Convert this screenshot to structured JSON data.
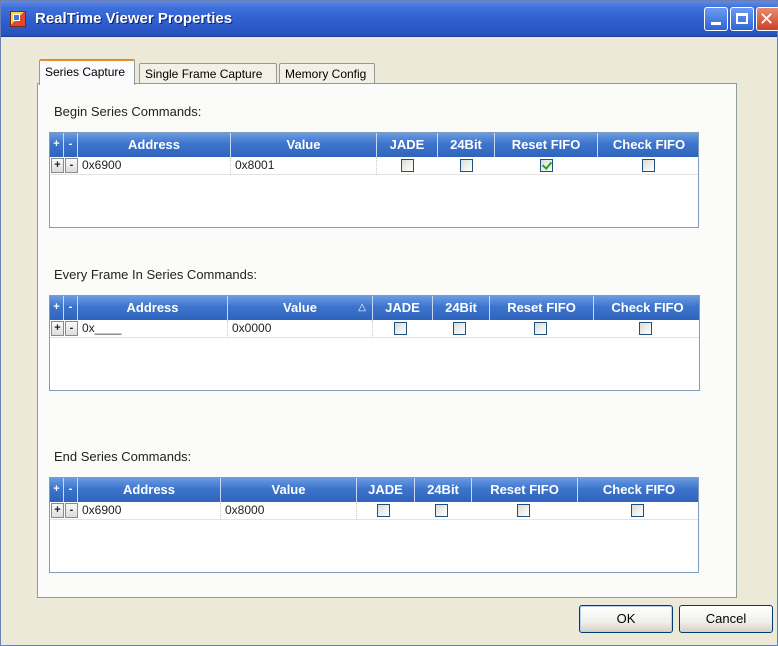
{
  "window": {
    "title": "RealTime Viewer Properties",
    "minimize_glyph": "",
    "close_glyph": "✕"
  },
  "tabs": [
    {
      "label": "Series Capture",
      "active": true
    },
    {
      "label": "Single Frame Capture",
      "active": false
    },
    {
      "label": "Memory Config",
      "active": false
    }
  ],
  "columns": {
    "plus": "+",
    "minus": "-",
    "address": "Address",
    "value": "Value",
    "jade": "JADE",
    "bit24": "24Bit",
    "reset_fifo": "Reset FIFO",
    "check_fifo": "Check FIFO"
  },
  "sections": {
    "begin": {
      "label": "Begin Series Commands:",
      "rows": [
        {
          "add": "+",
          "remove": "-",
          "address": "0x6900",
          "value": "0x8001",
          "jade": false,
          "bit24": false,
          "reset_fifo": true,
          "check_fifo": false
        }
      ]
    },
    "every": {
      "label": "Every Frame In Series Commands:",
      "sort_indicator": "△",
      "rows": [
        {
          "add": "+",
          "remove": "-",
          "address": "0x____",
          "value": "0x0000",
          "jade": false,
          "bit24": false,
          "reset_fifo": false,
          "check_fifo": false
        }
      ]
    },
    "end": {
      "label": "End Series Commands:",
      "rows": [
        {
          "add": "+",
          "remove": "-",
          "address": "0x6900",
          "value": "0x8000",
          "jade": false,
          "bit24": false,
          "reset_fifo": false,
          "check_fifo": false
        }
      ]
    }
  },
  "buttons": {
    "ok": "OK",
    "cancel": "Cancel"
  }
}
